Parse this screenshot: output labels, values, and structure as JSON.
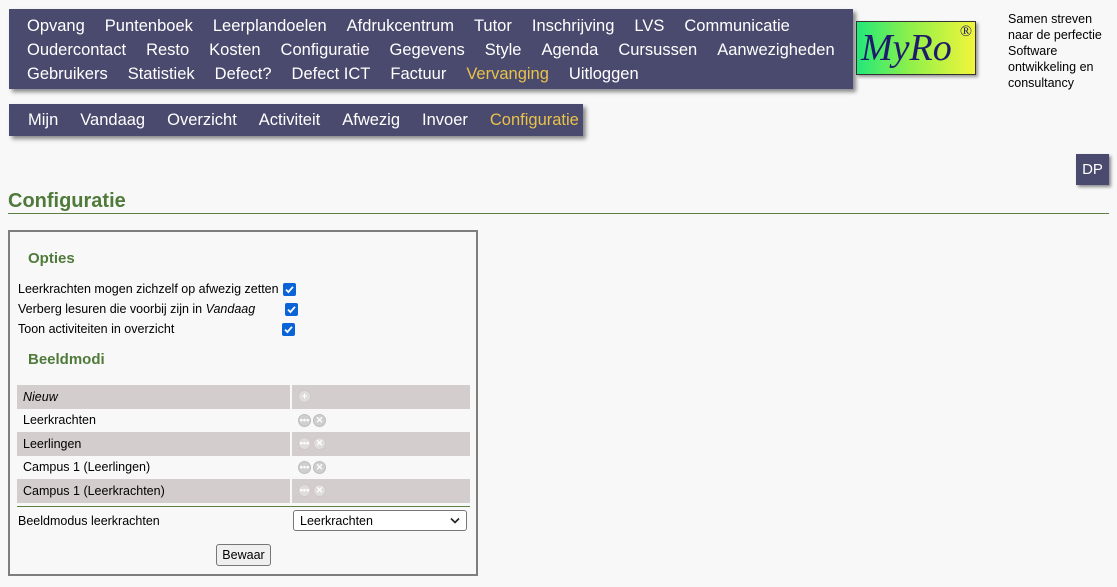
{
  "main_menu": {
    "rows": [
      [
        "Opvang",
        "Puntenboek",
        "Leerplandoelen",
        "Afdrukcentrum",
        "Tutor",
        "Inschrijving",
        "LVS",
        "Communicatie"
      ],
      [
        "Oudercontact",
        "Resto",
        "Kosten",
        "Configuratie",
        "Gegevens",
        "Style",
        "Agenda",
        "Cursussen",
        "Aanwezigheden"
      ],
      [
        "Gebruikers",
        "Statistiek",
        "Defect?",
        "Defect ICT",
        "Factuur",
        "Vervanging",
        "Uitloggen"
      ]
    ],
    "active": "Vervanging"
  },
  "logo": {
    "text": "MyRo",
    "mark": "®"
  },
  "tagline": [
    "Samen streven",
    "naar de perfectie",
    "Software",
    "ontwikkeling en",
    "consultancy"
  ],
  "sub_menu": {
    "items": [
      "Mijn",
      "Vandaag",
      "Overzicht",
      "Activiteit",
      "Afwezig",
      "Invoer",
      "Configuratie"
    ],
    "active": "Configuratie"
  },
  "user_button": "DP",
  "page_title": "Configuratie",
  "options": {
    "title": "Opties",
    "items": [
      {
        "label": "Leerkrachten mogen zichzelf op afwezig zetten",
        "checked": true
      },
      {
        "label_prefix": "Verberg lesuren die voorbij zijn in ",
        "label_em": "Vandaag",
        "checked": true
      },
      {
        "label": "Toon activiteiten in overzicht",
        "checked": true
      }
    ]
  },
  "display_modes": {
    "title": "Beeldmodi",
    "new_label": "Nieuw",
    "rows": [
      "Leerkrachten",
      "Leerlingen",
      "Campus 1 (Leerlingen)",
      "Campus 1 (Leerkrachten)"
    ]
  },
  "teacher_mode": {
    "label": "Beeldmodus leerkrachten",
    "selected": "Leerkrachten"
  },
  "save_label": "Bewaar",
  "colors": {
    "menu_bg": "#4a4a6e",
    "menu_active": "#e8c24a",
    "heading_green": "#4f7a3a",
    "checkbox_blue": "#0a64d8",
    "row_shade": "#d3cdcd"
  }
}
